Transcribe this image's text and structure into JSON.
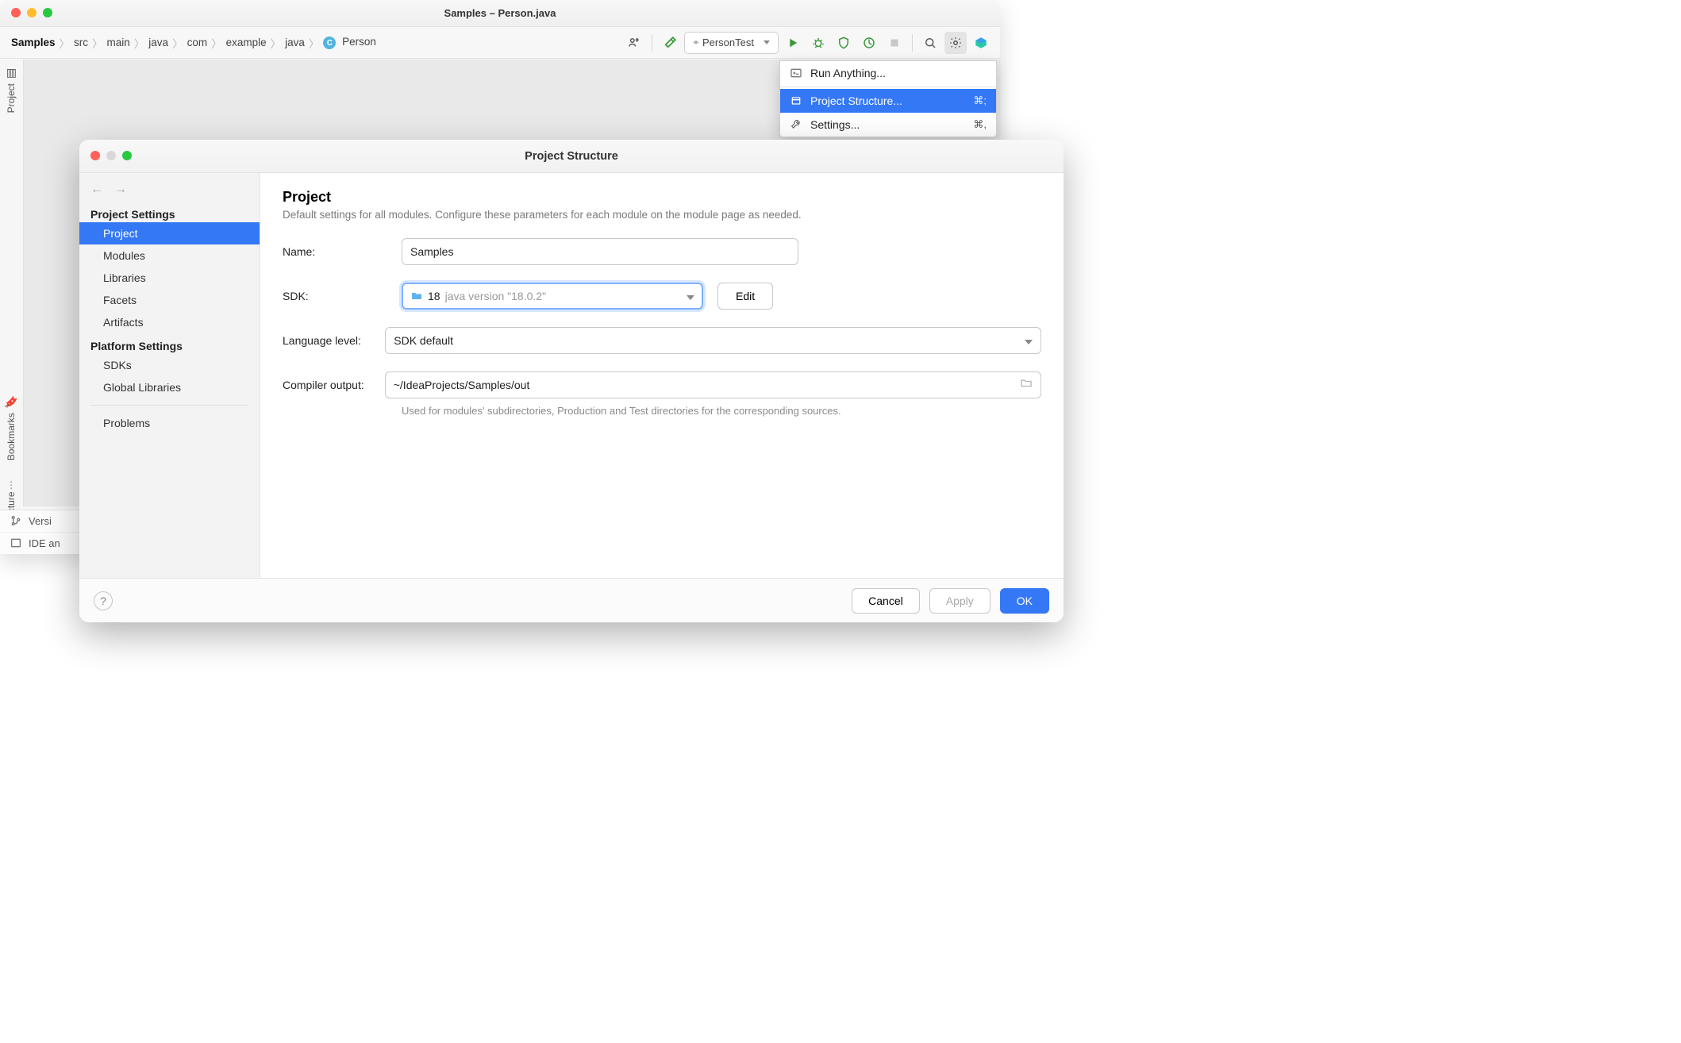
{
  "window": {
    "title": "Samples – Person.java"
  },
  "breadcrumbs": [
    "Samples",
    "src",
    "main",
    "java",
    "com",
    "example",
    "java",
    "Person"
  ],
  "runConfig": {
    "label": "PersonTest"
  },
  "leftTabs": {
    "project": "Project",
    "bookmarks": "Bookmarks",
    "structure": "Structure"
  },
  "status": {
    "versionControl": "Versi",
    "ideStatus": "IDE an"
  },
  "gearMenu": {
    "runAnything": "Run Anything...",
    "projectStructure": "Project Structure...",
    "projectStructureShortcut": "⌘;",
    "settings": "Settings...",
    "settingsShortcut": "⌘,"
  },
  "dialog": {
    "title": "Project Structure",
    "sidebar": {
      "projectSettings": "Project Settings",
      "items": {
        "project": "Project",
        "modules": "Modules",
        "libraries": "Libraries",
        "facets": "Facets",
        "artifacts": "Artifacts"
      },
      "platformSettings": "Platform Settings",
      "platformItems": {
        "sdks": "SDKs",
        "globalLibraries": "Global Libraries"
      },
      "problems": "Problems"
    },
    "main": {
      "heading": "Project",
      "description": "Default settings for all modules. Configure these parameters for each module on the module page as needed.",
      "nameLabel": "Name:",
      "nameValue": "Samples",
      "sdkLabel": "SDK:",
      "sdkValue": "18",
      "sdkVersion": "java version \"18.0.2\"",
      "editBtn": "Edit",
      "languageLabel": "Language level:",
      "languageValue": "SDK default",
      "compilerLabel": "Compiler output:",
      "compilerValue": "~/IdeaProjects/Samples/out",
      "compilerHint": "Used for modules' subdirectories, Production and Test directories for the corresponding sources."
    },
    "footer": {
      "cancel": "Cancel",
      "apply": "Apply",
      "ok": "OK"
    }
  }
}
